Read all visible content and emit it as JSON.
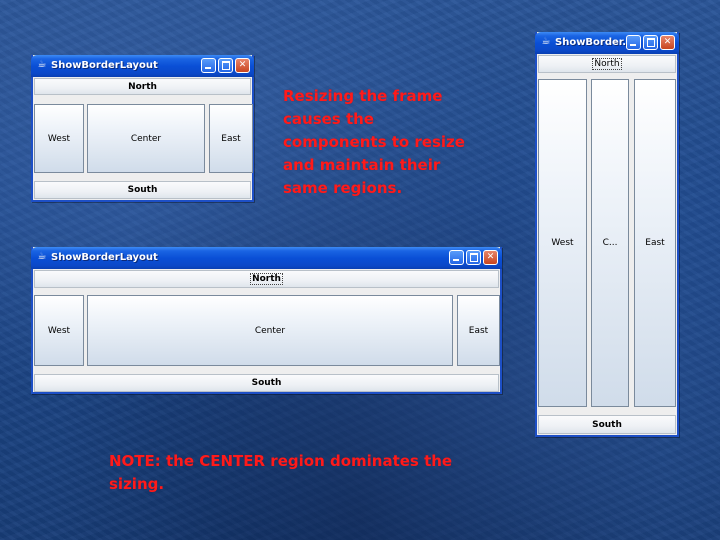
{
  "window_small": {
    "title": "ShowBorderLayout",
    "north": "North",
    "west": "West",
    "center": "Center",
    "east": "East",
    "south": "South"
  },
  "window_wide": {
    "title": "ShowBorderLayout",
    "north": "North",
    "west": "West",
    "center": "Center",
    "east": "East",
    "south": "South"
  },
  "window_tall": {
    "title": "ShowBorder...",
    "north": "North",
    "west": "West",
    "center": "C...",
    "east": "East",
    "south": "South"
  },
  "captions": {
    "resize_note": "Resizing the frame causes the components to resize and maintain their same regions.",
    "center_note": "NOTE: the CENTER region dominates the sizing."
  },
  "icons": {
    "app": "java-cup-icon",
    "minimize": "minimize-icon",
    "maximize": "maximize-icon",
    "close": "close-icon"
  },
  "colors": {
    "caption": "#ff1a1a",
    "titlebar": "#0a4fd6",
    "background": "#1f4a8e"
  }
}
